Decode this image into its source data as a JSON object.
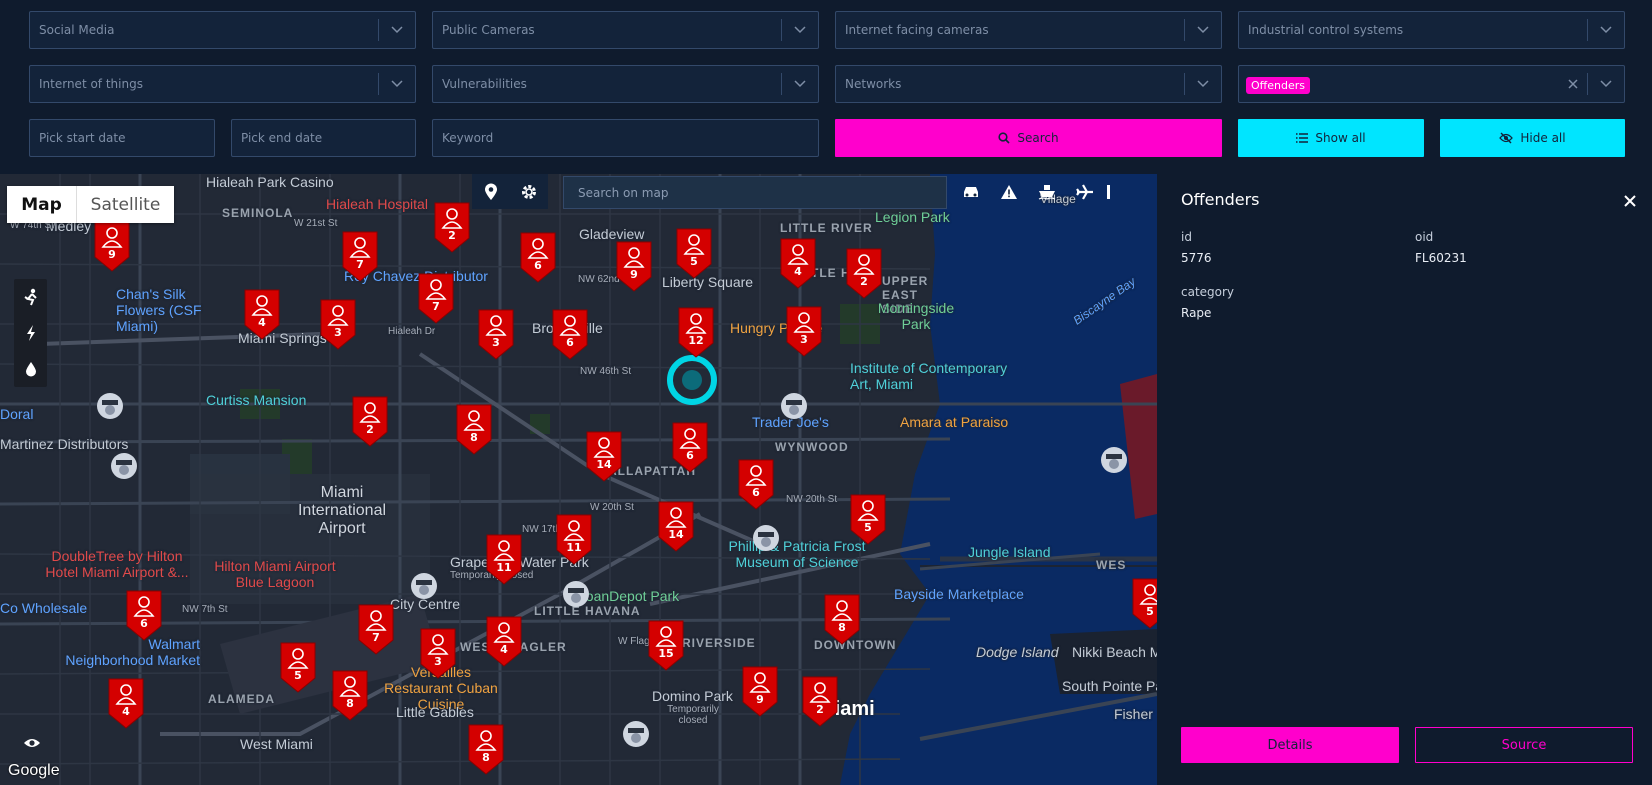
{
  "filters": {
    "row1": [
      "Social Media",
      "Public Cameras",
      "Internet facing cameras",
      "Industrial control systems"
    ],
    "row2": [
      "Internet of things",
      "Vulnerabilities",
      "Networks"
    ],
    "offenders_chip": "Offenders",
    "start_date_placeholder": "Pick start date",
    "end_date_placeholder": "Pick end date",
    "keyword_placeholder": "Keyword",
    "search_label": "Search",
    "show_all_label": "Show all",
    "hide_all_label": "Hide all"
  },
  "map": {
    "map_type": "Map",
    "satellite_type": "Satellite",
    "search_placeholder": "Search on map",
    "attribution": "Google",
    "labels": {
      "medley": "Medley",
      "seminola": "SEMINOLA",
      "hialeah_casino": "Hialeah Park Casino",
      "hialeah_hospital": "Hialeah Hospital",
      "nw74": "W 74th St",
      "w21": "W 21st St",
      "gladeview": "Gladeview",
      "liberty_square": "Liberty Square",
      "nw62": "NW 62nd St",
      "little_river": "LITTLE RIVER",
      "legion_park": "Legion Park",
      "village": "Village",
      "little_haiti": "LITTLE HAITI",
      "upper_eastside": "UPPER EAST SIDE",
      "morningside": "Morningside Park",
      "chans": "Chan's Silk Flowers (CSF Miami)",
      "rey_chavez": "Rey Chavez Distributor",
      "miami_springs": "Miami Springs",
      "hialeah_dr": "Hialeah Dr",
      "brownsville": "Brownsville",
      "hungry": "Hungry People",
      "institute": "Institute of Contemporary Art, Miami",
      "biscayne_bay": "Biscayne Bay",
      "nw46": "NW 46th St",
      "curtiss": "Curtiss Mansion",
      "doral": "Doral",
      "martinez": "Martinez Distributors",
      "trader_joes": "Trader Joe's",
      "amara": "Amara at Paraiso",
      "wynwood": "WYNWOOD",
      "allapattah": "ALLAPATTAH",
      "airport": "Miami International Airport",
      "nw20": "NW 20th St",
      "w20": "W 20th St",
      "nw17": "NW 17th St",
      "frost": "Phillip & Patricia Frost Museum of Science",
      "jungle": "Jungle Island",
      "doubletree": "DoubleTree by Hilton Hotel Miami Airport &...",
      "hilton": "Hilton Miami Airport Blue Lagoon",
      "grapeland": "Grapeland Water Park",
      "temp_closed_1": "Temporarily closed",
      "city_center": "City Centre",
      "loandepot": "LoanDepot Park",
      "little_havana": "LITTLE HAVANA",
      "bayside": "Bayside Marketplace",
      "wholesale": "Co Wholesale",
      "nw7": "NW 7th St",
      "walmart": "Walmart Neighborhood Market",
      "west_flagler": "WEST FLAGLER",
      "w_flagler": "W Flagler St",
      "riverside": "RIVERSIDE",
      "downtown": "DOWNTOWN",
      "dodge": "Dodge Island",
      "nikki": "Nikki Beach M",
      "versailles": "Versailles Restaurant Cuban Cuisine",
      "domino": "Domino Park",
      "temp_closed_2": "Temporarily closed",
      "south_pointe": "South Pointe Pa",
      "fisher": "Fisher",
      "alameda": "ALAMEDA",
      "little_gables": "Little Gables",
      "miami": "Miami",
      "west_miami": "West Miami",
      "west": "WES"
    },
    "clusters": [
      "9",
      "7",
      "2",
      "6",
      "9",
      "5",
      "4",
      "2",
      "4",
      "3",
      "7",
      "3",
      "6",
      "12",
      "3",
      "2",
      "8",
      "14",
      "6",
      "6",
      "14",
      "11",
      "11",
      "5",
      "6",
      "7",
      "3",
      "4",
      "15",
      "8",
      "9",
      "2",
      "5",
      "8",
      "4",
      "8",
      "5"
    ]
  },
  "panel": {
    "title": "Offenders",
    "fields": {
      "id_key": "id",
      "id_value": "5776",
      "oid_key": "oid",
      "oid_value": "FL60231",
      "category_key": "category",
      "category_value": "Rape"
    },
    "details_label": "Details",
    "source_label": "Source"
  }
}
